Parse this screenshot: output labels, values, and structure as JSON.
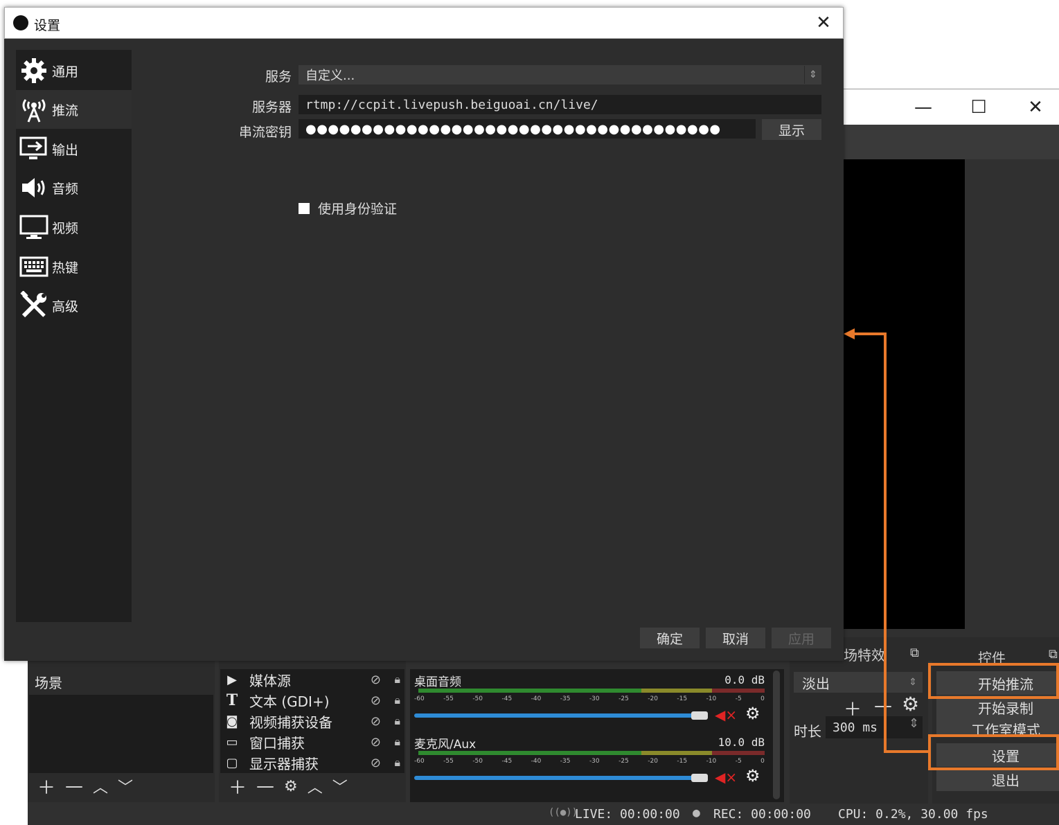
{
  "settings": {
    "title": "设置",
    "sidebar": [
      {
        "label": "通用",
        "icon": "gear-icon"
      },
      {
        "label": "推流",
        "icon": "broadcast-antenna-icon"
      },
      {
        "label": "输出",
        "icon": "output-monitor-icon"
      },
      {
        "label": "音频",
        "icon": "speaker-icon"
      },
      {
        "label": "视频",
        "icon": "monitor-icon"
      },
      {
        "label": "热键",
        "icon": "keyboard-icon"
      },
      {
        "label": "高级",
        "icon": "tools-icon"
      }
    ],
    "active_item": "推流",
    "service_label": "服务",
    "service_value": "自定义...",
    "server_label": "服务器",
    "server_value": "rtmp://ccpit.livepush.beiguoai.cn/live/",
    "key_label": "串流密钥",
    "key_value": "●●●●●●●●●●●●●●●●●●●●●●●●●●●●●●●●●●●●●",
    "show_button": "显示",
    "auth_checkbox_label": "使用身份验证",
    "ok_button": "确定",
    "cancel_button": "取消",
    "apply_button": "应用"
  },
  "main": {
    "scenes": {
      "items": [
        "场景"
      ]
    },
    "sources": {
      "items": [
        {
          "label": "媒体源",
          "icon": "play-icon"
        },
        {
          "label": "文本 (GDI+)",
          "icon": "text-icon"
        },
        {
          "label": "视频捕获设备",
          "icon": "camera-icon"
        },
        {
          "label": "窗口捕获",
          "icon": "window-icon"
        },
        {
          "label": "显示器捕获",
          "icon": "display-icon"
        }
      ]
    },
    "mixer": {
      "channels": [
        {
          "name": "桌面音频",
          "db": "0.0 dB"
        },
        {
          "name": "麦克风/Aux",
          "db": "10.0 dB"
        }
      ],
      "ticks": [
        "-60",
        "-55",
        "-50",
        "-45",
        "-40",
        "-35",
        "-30",
        "-25",
        "-20",
        "-15",
        "-10",
        "-5",
        "0"
      ]
    },
    "transitions": {
      "header": "场特效",
      "selected": "淡出",
      "duration_label": "时长",
      "duration_value": "300 ms"
    },
    "controls": {
      "header": "控件",
      "start_stream": "开始推流",
      "start_record": "开始录制",
      "studio_mode": "工作室模式",
      "settings": "设置",
      "exit": "退出"
    },
    "status": {
      "live": "LIVE: 00:00:00",
      "rec": "REC: 00:00:00",
      "cpu": "CPU: 0.2%, 30.00 fps"
    }
  },
  "colors": {
    "annotation": "#e8792b",
    "mute": "#e02424",
    "volume": "#2e8bd6"
  }
}
